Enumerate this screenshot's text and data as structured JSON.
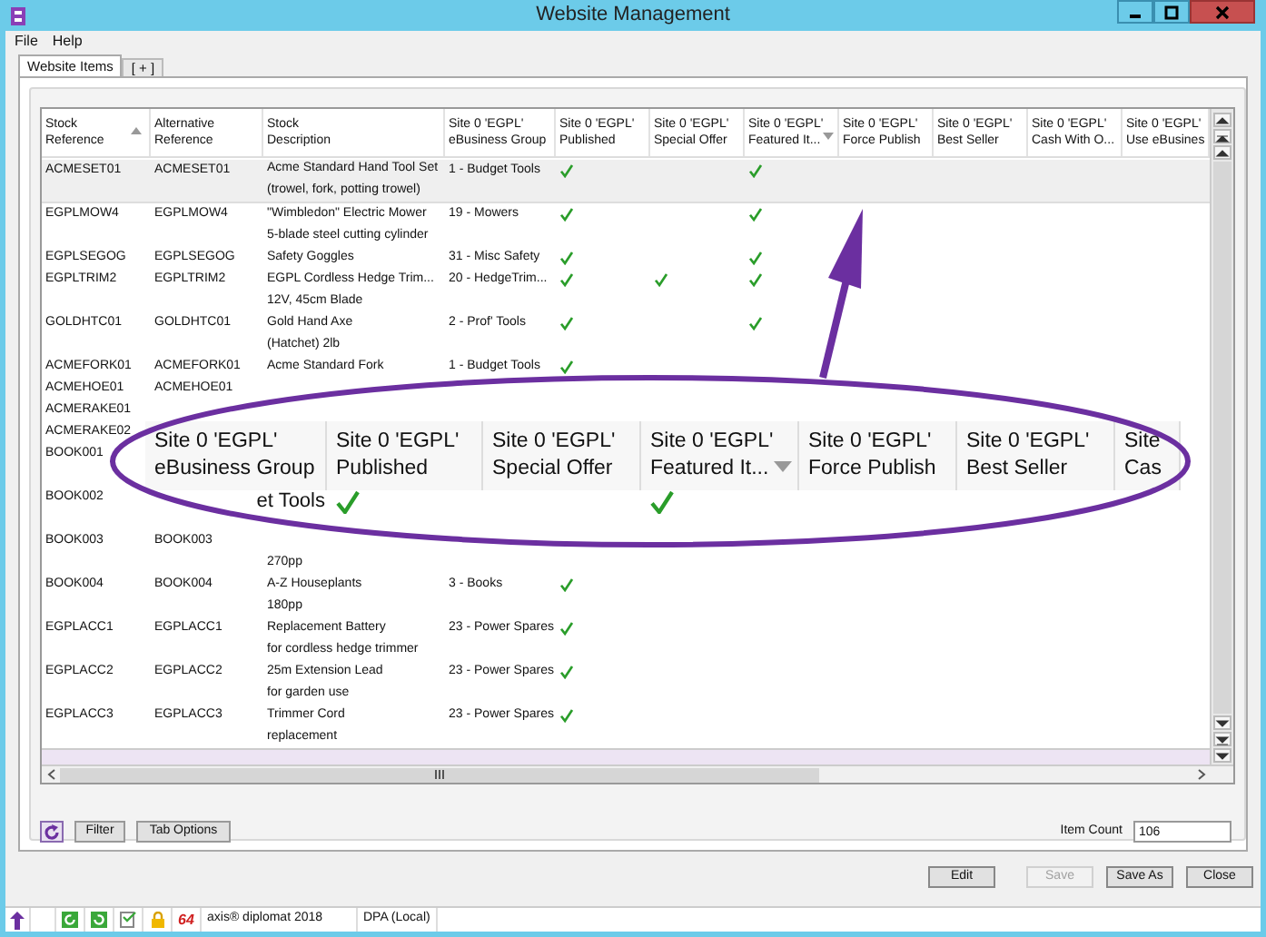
{
  "window": {
    "title": "Website Management"
  },
  "menu": [
    "File",
    "Help"
  ],
  "tabs": [
    {
      "label": "Website Items",
      "selected": true
    },
    {
      "label": "[ + ]",
      "selected": false
    }
  ],
  "table": {
    "columns": [
      {
        "lines": [
          "Stock",
          "Reference"
        ],
        "sort_up": true,
        "sort_down": false
      },
      {
        "lines": [
          "Alternative",
          "Reference"
        ],
        "sort_up": false,
        "sort_down": false
      },
      {
        "lines": [
          "Stock",
          "Description"
        ],
        "sort_up": false,
        "sort_down": false
      },
      {
        "lines": [
          "Site 0 'EGPL'",
          "eBusiness Group"
        ],
        "sort_up": false,
        "sort_down": false
      },
      {
        "lines": [
          "Site 0 'EGPL'",
          "Published"
        ],
        "sort_up": false,
        "sort_down": false
      },
      {
        "lines": [
          "Site 0 'EGPL'",
          "Special Offer"
        ],
        "sort_up": false,
        "sort_down": false
      },
      {
        "lines": [
          "Site 0 'EGPL'",
          "Featured It..."
        ],
        "sort_up": false,
        "sort_down": true
      },
      {
        "lines": [
          "Site 0 'EGPL'",
          "Force Publish"
        ],
        "sort_up": false,
        "sort_down": false
      },
      {
        "lines": [
          "Site 0 'EGPL'",
          "Best Seller"
        ],
        "sort_up": false,
        "sort_down": false
      },
      {
        "lines": [
          "Site 0 'EGPL'",
          "Cash With O..."
        ],
        "sort_up": false,
        "sort_down": false
      },
      {
        "lines": [
          "Site 0 'EGPL'",
          "Use eBusines"
        ],
        "sort_up": false,
        "sort_down": false
      }
    ],
    "rows": [
      {
        "kind": "two-line",
        "selected": true,
        "stock_reference": "ACMESET01",
        "alternative_reference": "ACMESET01",
        "description": [
          "Acme Standard Hand Tool Set",
          "(trowel, fork, potting trowel)"
        ],
        "ebusiness_group": "1 - Budget Tools",
        "published": true,
        "special_offer": false,
        "featured": true
      },
      {
        "kind": "two-line",
        "selected": false,
        "stock_reference": "EGPLMOW4",
        "alternative_reference": "EGPLMOW4",
        "description": [
          "\"Wimbledon\" Electric Mower",
          "5-blade steel cutting cylinder"
        ],
        "ebusiness_group": "19 - Mowers",
        "published": true,
        "special_offer": false,
        "featured": true
      },
      {
        "kind": "one-line",
        "selected": false,
        "stock_reference": "EGPLSEGOG",
        "alternative_reference": "EGPLSEGOG",
        "description": [
          "Safety Goggles"
        ],
        "ebusiness_group": "31 - Misc Safety",
        "published": true,
        "special_offer": false,
        "featured": true
      },
      {
        "kind": "two-line",
        "selected": false,
        "stock_reference": "EGPLTRIM2",
        "alternative_reference": "EGPLTRIM2",
        "description": [
          "EGPL Cordless Hedge Trim...",
          "12V, 45cm Blade"
        ],
        "ebusiness_group": "20 - HedgeTrim...",
        "published": true,
        "special_offer": true,
        "featured": true
      },
      {
        "kind": "two-line",
        "selected": false,
        "stock_reference": "GOLDHTC01",
        "alternative_reference": "GOLDHTC01",
        "description": [
          "Gold Hand Axe",
          "(Hatchet) 2lb"
        ],
        "ebusiness_group": "2 - Prof' Tools",
        "published": true,
        "special_offer": false,
        "featured": true
      },
      {
        "kind": "one-line",
        "selected": false,
        "stock_reference": "ACMEFORK01",
        "alternative_reference": "ACMEFORK01",
        "description": [
          "Acme Standard Fork"
        ],
        "ebusiness_group": "1 - Budget Tools",
        "published": true,
        "special_offer": false,
        "featured": false
      },
      {
        "kind": "one-line",
        "selected": false,
        "stock_reference": "ACMEHOE01",
        "alternative_reference": "ACMEHOE01"
      },
      {
        "kind": "one-line",
        "selected": false,
        "stock_reference": "ACMERAKE01"
      },
      {
        "kind": "one-line",
        "selected": false,
        "stock_reference": "ACMERAKE02"
      },
      {
        "kind": "two-line",
        "selected": false,
        "stock_reference": "BOOK001"
      },
      {
        "kind": "two-line",
        "selected": false,
        "stock_reference": "BOOK002"
      },
      {
        "kind": "two-line",
        "selected": false,
        "stock_reference": "BOOK003",
        "alternative_reference": "BOOK003",
        "description": [
          "270pp"
        ]
      },
      {
        "kind": "two-line",
        "selected": false,
        "stock_reference": "BOOK004",
        "alternative_reference": "BOOK004",
        "description": [
          "A-Z Houseplants",
          "180pp"
        ],
        "ebusiness_group": "3 - Books",
        "published": true,
        "special_offer": false,
        "featured": false
      },
      {
        "kind": "two-line",
        "selected": false,
        "stock_reference": "EGPLACC1",
        "alternative_reference": "EGPLACC1",
        "description": [
          "Replacement Battery",
          "for cordless hedge trimmer"
        ],
        "ebusiness_group": "23 - Power Spares",
        "published": true,
        "special_offer": false,
        "featured": false
      },
      {
        "kind": "two-line",
        "selected": false,
        "stock_reference": "EGPLACC2",
        "alternative_reference": "EGPLACC2",
        "description": [
          "25m Extension Lead",
          "for garden use"
        ],
        "ebusiness_group": "23 - Power Spares",
        "published": true,
        "special_offer": false,
        "featured": false
      },
      {
        "kind": "two-line",
        "selected": false,
        "stock_reference": "EGPLACC3",
        "alternative_reference": "EGPLACC3",
        "description": [
          "Trimmer Cord",
          "replacement"
        ],
        "ebusiness_group": "23 - Power Spares",
        "published": true,
        "special_offer": false,
        "featured": false
      }
    ]
  },
  "callout": {
    "columns": [
      {
        "lines": [
          "Site 0 'EGPL'",
          "eBusiness Group"
        ],
        "sort_down": false
      },
      {
        "lines": [
          "Site 0 'EGPL'",
          "Published"
        ],
        "sort_down": false
      },
      {
        "lines": [
          "Site 0 'EGPL'",
          "Special Offer"
        ],
        "sort_down": false
      },
      {
        "lines": [
          "Site 0 'EGPL'",
          "Featured It..."
        ],
        "sort_down": true
      },
      {
        "lines": [
          "Site 0 'EGPL'",
          "Force Publish"
        ],
        "sort_down": false
      },
      {
        "lines": [
          "Site 0 'EGPL'",
          "Best Seller"
        ],
        "sort_down": false
      },
      {
        "lines": [
          "Site",
          "Cas"
        ],
        "sort_down": false
      }
    ],
    "row": {
      "ebusiness_group": "et Tools",
      "published": true,
      "special_offer": false,
      "featured": true
    }
  },
  "bottom_bar": {
    "buttons": [
      "Filter",
      "Tab Options"
    ],
    "item_count_label": "Item Count",
    "item_count": "106"
  },
  "dialog_buttons": [
    {
      "label": "Edit",
      "disabled": false
    },
    {
      "label": "Save",
      "disabled": true
    },
    {
      "label": "Save As",
      "disabled": false
    },
    {
      "label": "Close",
      "disabled": false
    }
  ],
  "status_bar": {
    "badge": "64",
    "product": "axis® diplomat 2018",
    "connection": "DPA (Local)"
  }
}
